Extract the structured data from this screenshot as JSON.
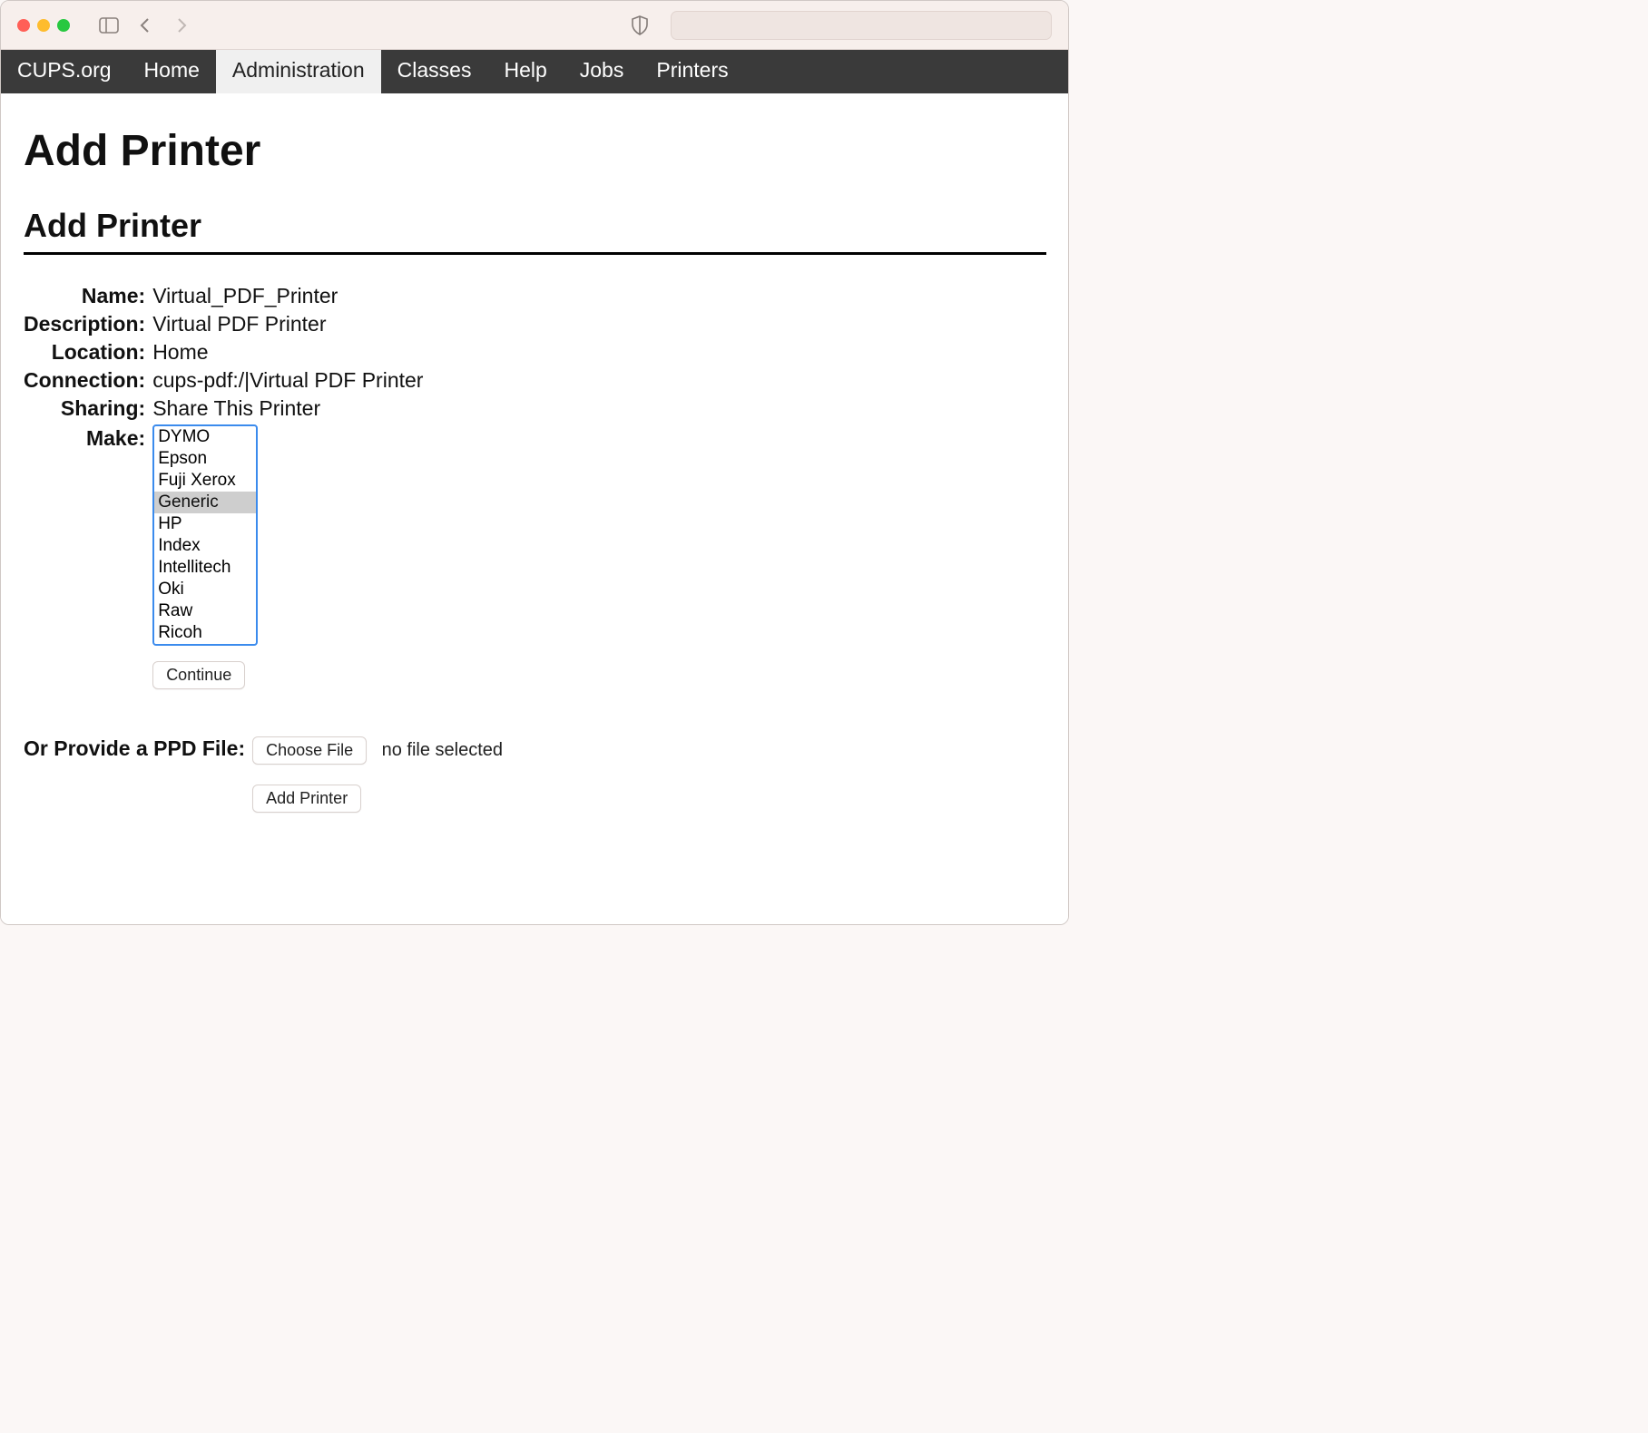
{
  "nav": {
    "items": [
      "CUPS.org",
      "Home",
      "Administration",
      "Classes",
      "Help",
      "Jobs",
      "Printers"
    ],
    "activeIndex": 2
  },
  "headings": {
    "h1": "Add Printer",
    "h2": "Add Printer"
  },
  "labels": {
    "name": "Name:",
    "description": "Description:",
    "location": "Location:",
    "connection": "Connection:",
    "sharing": "Sharing:",
    "make": "Make:",
    "ppd": "Or Provide a PPD File:"
  },
  "values": {
    "name": "Virtual_PDF_Printer",
    "description": "Virtual PDF Printer",
    "location": "Home",
    "connection": "cups-pdf:/|Virtual PDF Printer",
    "sharing": "Share This Printer"
  },
  "make": {
    "options": [
      "DYMO",
      "Epson",
      "Fuji Xerox",
      "Generic",
      "HP",
      "Index",
      "Intellitech",
      "Oki",
      "Raw",
      "Ricoh"
    ],
    "selected": "Generic"
  },
  "buttons": {
    "continue": "Continue",
    "choose_file": "Choose File",
    "add_printer": "Add Printer"
  },
  "file": {
    "status": "no file selected"
  }
}
